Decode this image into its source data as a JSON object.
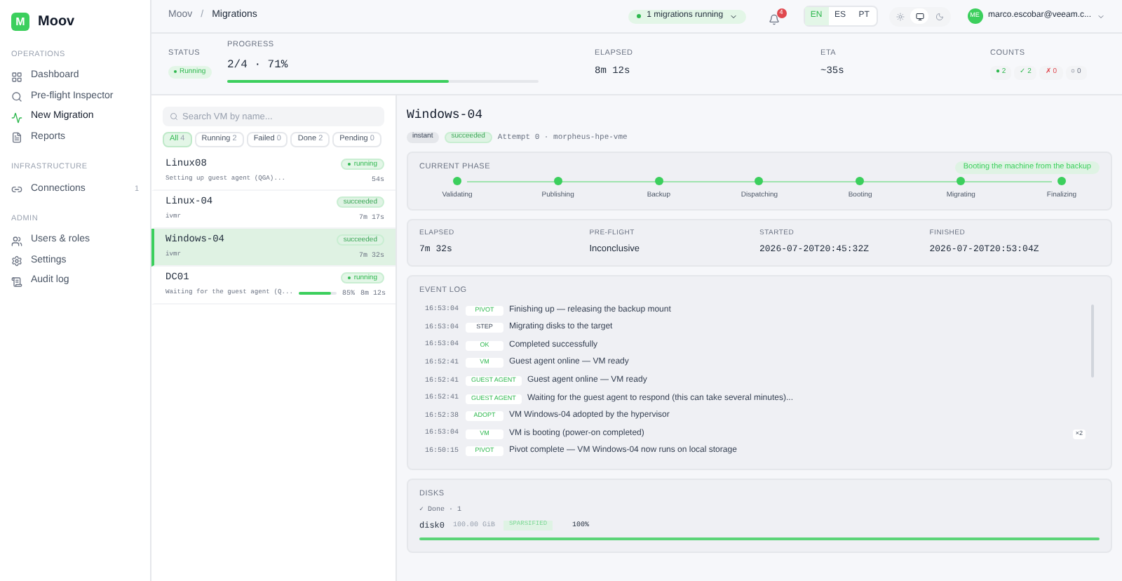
{
  "brand": {
    "logo": "M",
    "name": "Moov"
  },
  "sidebar": {
    "sections": [
      {
        "title": "OPERATIONS",
        "items": [
          {
            "label": "Dashboard",
            "selected": false
          },
          {
            "label": "Pre-flight Inspector",
            "selected": false
          },
          {
            "label": "New Migration",
            "selected": true
          },
          {
            "label": "Reports",
            "selected": false
          }
        ]
      },
      {
        "title": "INFRASTRUCTURE",
        "items": [
          {
            "label": "Connections",
            "selected": false,
            "count": "1"
          }
        ]
      },
      {
        "title": "ADMIN",
        "items": [
          {
            "label": "Users & roles",
            "selected": false
          },
          {
            "label": "Settings",
            "selected": false
          },
          {
            "label": "Audit log",
            "selected": false
          }
        ]
      }
    ]
  },
  "topbar": {
    "breadcrumb": [
      "Moov",
      "Migrations"
    ],
    "separator": "/",
    "running_pill": "1 migrations running",
    "notifications": "4",
    "languages": [
      {
        "label": "EN",
        "selected": true
      },
      {
        "label": "ES",
        "selected": false
      },
      {
        "label": "PT",
        "selected": false
      }
    ],
    "themes": [
      {
        "kind": "light",
        "selected": false
      },
      {
        "kind": "system",
        "selected": true
      },
      {
        "kind": "dark",
        "selected": false
      }
    ],
    "user": {
      "initials": "ME",
      "email": "marco.escobar@veeam.c..."
    }
  },
  "summary": {
    "status_label": "STATUS",
    "status": "Running",
    "progress_label": "PROGRESS",
    "progress": "2/4 · 71%",
    "level": 0.71,
    "elapsed_label": "ELAPSED",
    "elapsed": "8m 12s",
    "eta_label": "ETA",
    "eta": "~35s",
    "counts_label": "COUNTS",
    "counts": [
      {
        "kind": "running",
        "symbol": "●",
        "value": "2"
      },
      {
        "kind": "done",
        "symbol": "✓",
        "value": "2"
      },
      {
        "kind": "failed",
        "symbol": "✗",
        "value": "0"
      },
      {
        "kind": "pending",
        "symbol": "○",
        "value": "0"
      }
    ]
  },
  "search": {
    "placeholder": "Search VM by name..."
  },
  "filters": [
    {
      "label": "All",
      "count": "4",
      "selected": true
    },
    {
      "label": "Running",
      "count": "2",
      "selected": false
    },
    {
      "label": "Failed",
      "count": "0",
      "selected": false
    },
    {
      "label": "Done",
      "count": "2",
      "selected": false
    },
    {
      "label": "Pending",
      "count": "0",
      "selected": false
    }
  ],
  "vms": [
    {
      "name": "Linux08",
      "status": "running",
      "detail": "Setting up guest agent (QGA)...",
      "time": "54s",
      "selected": false
    },
    {
      "name": "Linux-04",
      "status": "succeeded",
      "detail": "ivmr",
      "time": "7m 17s",
      "selected": false
    },
    {
      "name": "Windows-04",
      "status": "succeeded",
      "detail": "ivmr",
      "time": "7m 32s",
      "selected": true
    },
    {
      "name": "DC01",
      "status": "running",
      "detail": "Waiting for the guest agent (Q...",
      "level": 0.85,
      "percent": "85%",
      "time": "8m 12s",
      "selected": false
    }
  ],
  "detail": {
    "title": "Windows-04",
    "mode": "instant",
    "status": "succeeded",
    "meta": "Attempt 0 · morpheus-hpe-vme",
    "phase_label": "CURRENT PHASE",
    "phase_note": "Booting the machine from the backup",
    "phases": [
      {
        "label": "Validating",
        "done": true
      },
      {
        "label": "Publishing",
        "done": true
      },
      {
        "label": "Backup",
        "done": true
      },
      {
        "label": "Dispatching",
        "done": true
      },
      {
        "label": "Booting",
        "done": true
      },
      {
        "label": "Migrating",
        "done": true
      },
      {
        "label": "Finalizing",
        "done": true
      }
    ],
    "facts": [
      {
        "label": "ELAPSED",
        "value": "7m 32s",
        "kind": "code"
      },
      {
        "label": "PRE-FLIGHT",
        "value": "Inconclusive",
        "kind": "text"
      },
      {
        "label": "STARTED",
        "value": "2026-07-20T20:45:32Z",
        "kind": "code"
      },
      {
        "label": "FINISHED",
        "value": "2026-07-20T20:53:04Z",
        "kind": "code"
      }
    ],
    "log_label": "EVENT LOG",
    "events": [
      {
        "time": "16:53:04",
        "tag": "PIVOT",
        "kind": "success",
        "message": "Finishing up — releasing the backup mount"
      },
      {
        "time": "16:53:04",
        "tag": "STEP",
        "kind": "neutral",
        "message": "Migrating disks to the target"
      },
      {
        "time": "16:53:04",
        "tag": "OK",
        "kind": "success",
        "message": "Completed successfully"
      },
      {
        "time": "16:52:41",
        "tag": "VM",
        "kind": "success",
        "message": "Guest agent online — VM ready"
      },
      {
        "time": "16:52:41",
        "tag": "GUEST AGENT",
        "kind": "success",
        "message": "Guest agent online — VM ready"
      },
      {
        "time": "16:52:41",
        "tag": "GUEST AGENT",
        "kind": "success",
        "message": "Waiting for the guest agent to respond (this can take several minutes)..."
      },
      {
        "time": "16:52:38",
        "tag": "ADOPT",
        "kind": "success",
        "message": "VM Windows-04 adopted by the hypervisor"
      },
      {
        "time": "16:53:04",
        "tag": "VM",
        "kind": "success",
        "message": "VM is booting (power-on completed)",
        "repeat": "×2"
      },
      {
        "time": "16:50:15",
        "tag": "PIVOT",
        "kind": "success",
        "message": "Pivot complete — VM Windows-04 now runs on local storage"
      }
    ],
    "disks_label": "DISKS",
    "disks_summary": "✓ Done · 1",
    "disks": [
      {
        "name": "disk0",
        "size": "100.00 GiB",
        "tag": "SPARSIFIED",
        "percent": "100%",
        "level": 1
      }
    ]
  }
}
